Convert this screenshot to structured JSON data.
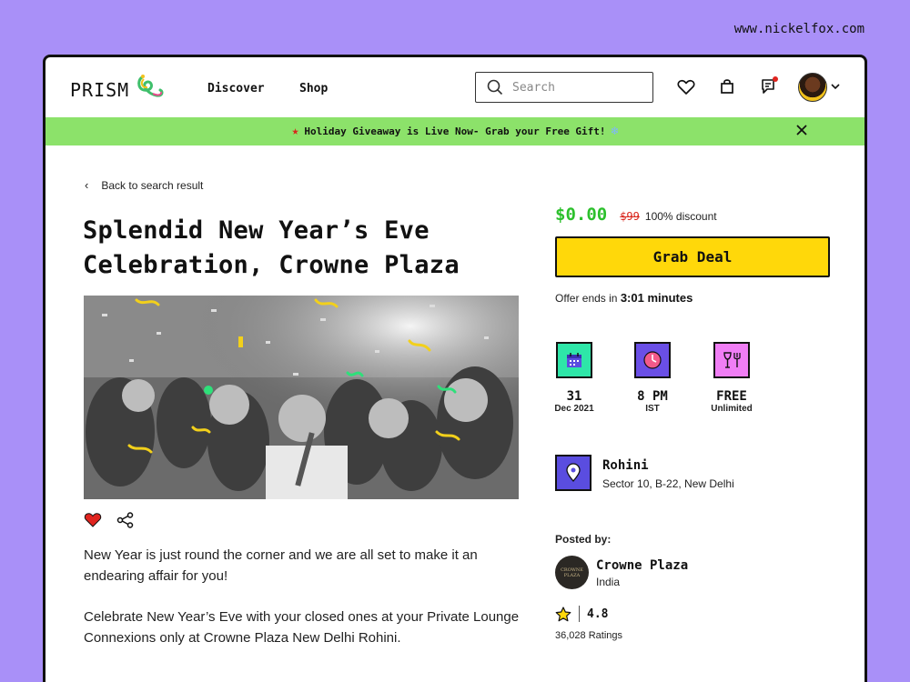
{
  "site_url": "www.nickelfox.com",
  "header": {
    "logo": "PRISM",
    "nav": [
      "Discover",
      "Shop"
    ],
    "search_placeholder": "Search"
  },
  "banner": {
    "text": "Holiday Giveaway is Live Now- Grab your Free Gift!"
  },
  "back_link": "Back to search result",
  "event": {
    "title_line1": "Splendid New Year’s Eve",
    "title_line2": "Celebration, Crowne Plaza",
    "description": [
      "New Year is just round the corner and we are all set to make it an endearing affair for you!",
      "Celebrate New Year’s Eve with your closed ones at your Private Lounge Connexions only at Crowne Plaza New Delhi Rohini."
    ]
  },
  "deal": {
    "price": "$0.00",
    "old_price": "$99",
    "discount": "100% discount",
    "cta": "Grab Deal",
    "offer_prefix": "Offer ends in",
    "offer_time": "3:01 minutes"
  },
  "info": [
    {
      "icon": "calendar-icon",
      "big": "31",
      "small": "Dec 2021",
      "color": "#2ee6a8"
    },
    {
      "icon": "clock-icon",
      "big": "8 PM",
      "small": "IST",
      "color": "#6a4fe6"
    },
    {
      "icon": "dining-icon",
      "big": "FREE",
      "small": "Unlimited",
      "color": "#f07ef5"
    }
  ],
  "location": {
    "name": "Rohini",
    "address": "Sector 10, B-22, New Delhi"
  },
  "posted_by": {
    "label": "Posted by:",
    "name": "Crowne Plaza",
    "country": "India",
    "logo_text": "CROWNE PLAZA"
  },
  "rating": {
    "value": "4.8",
    "count": "36,028 Ratings"
  },
  "colors": {
    "background": "#a990f8",
    "banner": "#8ce26a",
    "cta": "#ffd80a",
    "price": "#2cc02c",
    "strike": "#d9261c"
  }
}
